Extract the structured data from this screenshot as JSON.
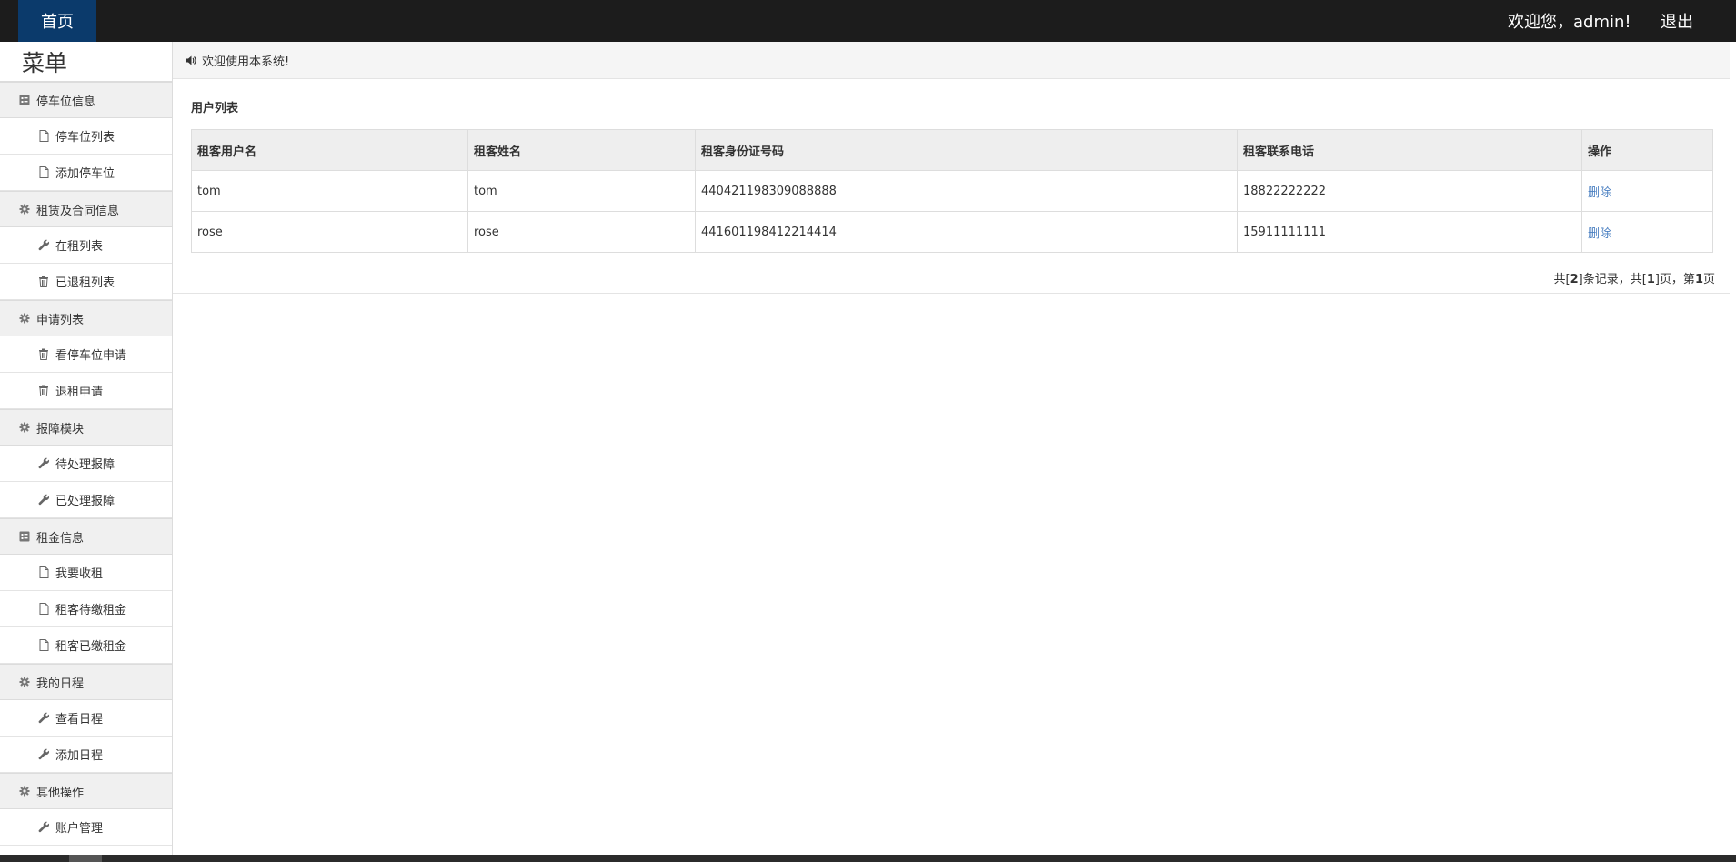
{
  "topbar": {
    "home_label": "首页",
    "welcome_label": "欢迎您，admin!",
    "logout_label": "退出"
  },
  "sidebar": {
    "title": "菜单",
    "groups": [
      {
        "label": "停车位信息",
        "icon": "list-alt-icon",
        "items": [
          {
            "label": "停车位列表",
            "icon": "file-icon"
          },
          {
            "label": "添加停车位",
            "icon": "file-icon"
          }
        ]
      },
      {
        "label": "租赁及合同信息",
        "icon": "gear-icon",
        "items": [
          {
            "label": "在租列表",
            "icon": "wrench-icon"
          },
          {
            "label": "已退租列表",
            "icon": "trash-icon"
          }
        ]
      },
      {
        "label": "申请列表",
        "icon": "gear-icon",
        "items": [
          {
            "label": "看停车位申请",
            "icon": "trash-icon"
          },
          {
            "label": "退租申请",
            "icon": "trash-icon"
          }
        ]
      },
      {
        "label": "报障模块",
        "icon": "gear-icon",
        "items": [
          {
            "label": "待处理报障",
            "icon": "wrench-icon"
          },
          {
            "label": "已处理报障",
            "icon": "wrench-icon"
          }
        ]
      },
      {
        "label": "租金信息",
        "icon": "list-alt-icon",
        "items": [
          {
            "label": "我要收租",
            "icon": "file-icon"
          },
          {
            "label": "租客待缴租金",
            "icon": "file-icon"
          },
          {
            "label": "租客已缴租金",
            "icon": "file-icon"
          }
        ]
      },
      {
        "label": "我的日程",
        "icon": "gear-icon",
        "items": [
          {
            "label": "查看日程",
            "icon": "wrench-icon"
          },
          {
            "label": "添加日程",
            "icon": "wrench-icon"
          }
        ]
      },
      {
        "label": "其他操作",
        "icon": "gear-icon",
        "items": [
          {
            "label": "账户管理",
            "icon": "wrench-icon"
          }
        ]
      }
    ]
  },
  "main": {
    "notice": "欢迎使用本系统!",
    "panel_title": "用户列表",
    "table": {
      "headers": [
        "租客用户名",
        "租客姓名",
        "租客身份证号码",
        "租客联系电话",
        "操作"
      ],
      "rows": [
        {
          "username": "tom",
          "name": "tom",
          "id_number": "440421198309088888",
          "phone": "18822222222",
          "action": "删除"
        },
        {
          "username": "rose",
          "name": "rose",
          "id_number": "441601198412214414",
          "phone": "15911111111",
          "action": "删除"
        }
      ]
    },
    "pager": {
      "prefix": "共[",
      "total": "2",
      "mid1": "]条记录，共[",
      "pages": "1",
      "mid2": "]页，第",
      "current": "1",
      "suffix": "页"
    }
  },
  "colors": {
    "topbar_bg": "#1c1c1c",
    "home_tab_bg": "#0b3a6b",
    "link": "#4a7fc1"
  }
}
